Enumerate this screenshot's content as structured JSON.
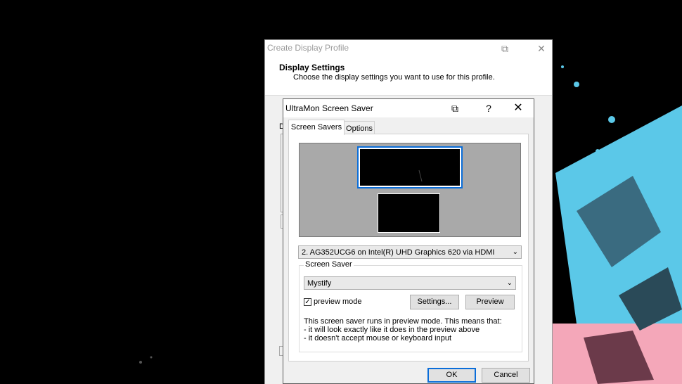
{
  "outer_dialog": {
    "title": "Create Display Profile",
    "header_title": "Display Settings",
    "header_subtitle": "Choose the display settings you want to use for this profile.",
    "ghost_letter": "D"
  },
  "inner_dialog": {
    "title": "UltraMon Screen Saver",
    "help_glyph": "?",
    "close_glyph": "✕",
    "restore_glyph": "⧉",
    "tabs": [
      {
        "label": "Screen Savers",
        "active": true
      },
      {
        "label": "Options",
        "active": false
      }
    ],
    "monitor_select": "2. AG352UCG6 on Intel(R) UHD Graphics 620 via HDMI",
    "screen_saver_group_label": "Screen Saver",
    "screen_saver_select": "Mystify",
    "preview_mode_label": "preview mode",
    "preview_mode_checked": true,
    "settings_button": "Settings...",
    "preview_button": "Preview",
    "note_lines": [
      "This screen saver runs in preview mode. This means that:",
      "- it will look exactly like it does in the preview above",
      "- it doesn't accept mouse or keyboard input"
    ],
    "ok_button": "OK",
    "cancel_button": "Cancel"
  },
  "colors": {
    "desktop_bg": "#000000",
    "splash_cyan": "#5bc8e8",
    "splash_pink": "#f4a7b9",
    "accent_blue": "#0a6dd9"
  }
}
